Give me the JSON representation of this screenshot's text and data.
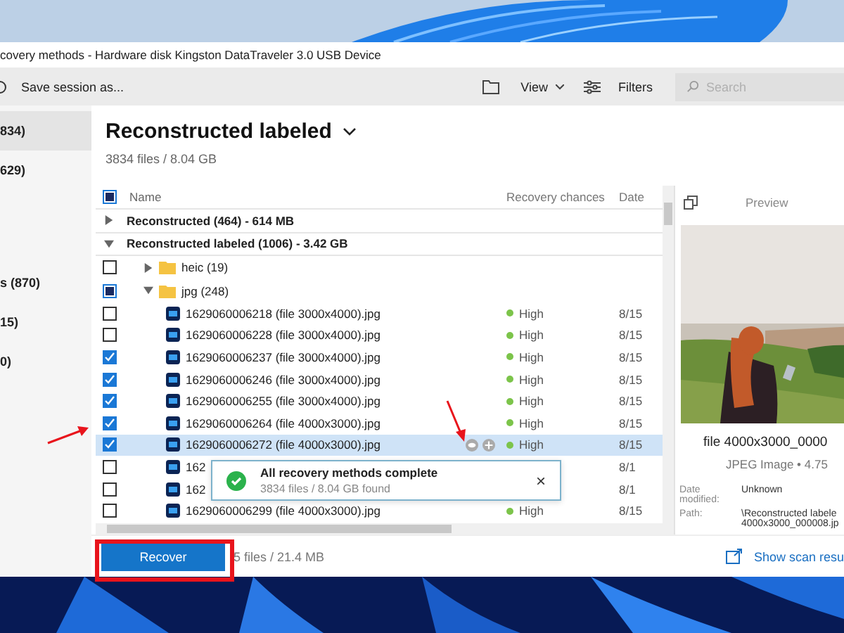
{
  "window": {
    "title": "covery methods - Hardware disk Kingston DataTraveler 3.0 USB Device"
  },
  "toolbar": {
    "save_session": "Save session as...",
    "view": "View",
    "filters": "Filters",
    "search": {
      "placeholder": "Search"
    }
  },
  "sidebar": {
    "items": [
      {
        "label": "834)",
        "selected": true
      },
      {
        "label": "629)",
        "selected": false
      },
      {
        "label": "s (870)",
        "selected": false
      },
      {
        "label": "15)",
        "selected": false
      },
      {
        "label": "0)",
        "selected": false
      }
    ]
  },
  "header": {
    "title": "Reconstructed labeled",
    "summary": "3834 files / 8.04 GB"
  },
  "table": {
    "select_all": {
      "checked": false,
      "partial": true
    },
    "columns": [
      "Name",
      "Recovery chances",
      "Date"
    ],
    "rows": [
      {
        "kind": "group",
        "name": "Reconstructed (464) - 614 MB",
        "expanded": false
      },
      {
        "kind": "group",
        "name": "Reconstructed labeled (1006) - 3.42 GB",
        "expanded": true,
        "children": [
          {
            "kind": "folder",
            "name": "heic (19)",
            "expanded": false,
            "checked": false,
            "partial": false
          },
          {
            "kind": "folder",
            "name": "jpg (248)",
            "expanded": true,
            "checked": false,
            "partial": true,
            "children": [
              {
                "kind": "file",
                "name": "1629060006218 (file 3000x4000).jpg",
                "chances": "High",
                "date": "8/15",
                "checked": false,
                "selected": false
              },
              {
                "kind": "file",
                "name": "1629060006228 (file 3000x4000).jpg",
                "chances": "High",
                "date": "8/15",
                "checked": false,
                "selected": false
              },
              {
                "kind": "file",
                "name": "1629060006237 (file 3000x4000).jpg",
                "chances": "High",
                "date": "8/15",
                "checked": true,
                "selected": false
              },
              {
                "kind": "file",
                "name": "1629060006246 (file 3000x4000).jpg",
                "chances": "High",
                "date": "8/15",
                "checked": true,
                "selected": false
              },
              {
                "kind": "file",
                "name": "1629060006255 (file 3000x4000).jpg",
                "chances": "High",
                "date": "8/15",
                "checked": true,
                "selected": false
              },
              {
                "kind": "file",
                "name": "1629060006264 (file 4000x3000).jpg",
                "chances": "High",
                "date": "8/15",
                "checked": true,
                "selected": false
              },
              {
                "kind": "file",
                "name": "1629060006272 (file 4000x3000).jpg",
                "chances": "High",
                "date": "8/15",
                "checked": true,
                "selected": true
              },
              {
                "kind": "file",
                "name": "162",
                "date": "8/1",
                "checked": false,
                "selected": false
              },
              {
                "kind": "file",
                "name": "162",
                "date": "8/1",
                "checked": false,
                "selected": false
              },
              {
                "kind": "file",
                "name": "1629060006299 (file 4000x3000).jpg",
                "chances": "High",
                "date": "8/15",
                "checked": false,
                "selected": false
              }
            ]
          }
        ]
      }
    ]
  },
  "toast": {
    "title": "All recovery methods complete",
    "message": "3834 files / 8.04 GB found",
    "close": "×"
  },
  "preview": {
    "label": "Preview",
    "file_name": "file 4000x3000_0000",
    "file_type": "JPEG Image • 4.75",
    "details": [
      {
        "label": "Date modified:",
        "value": "Unknown"
      },
      {
        "label": "Path:",
        "value": "\\Reconstructed labele 4000x3000_000008.jp"
      }
    ]
  },
  "footer": {
    "recover": "Recover",
    "selection": "5 files / 21.4 MB",
    "show_results": "Show scan resu"
  }
}
